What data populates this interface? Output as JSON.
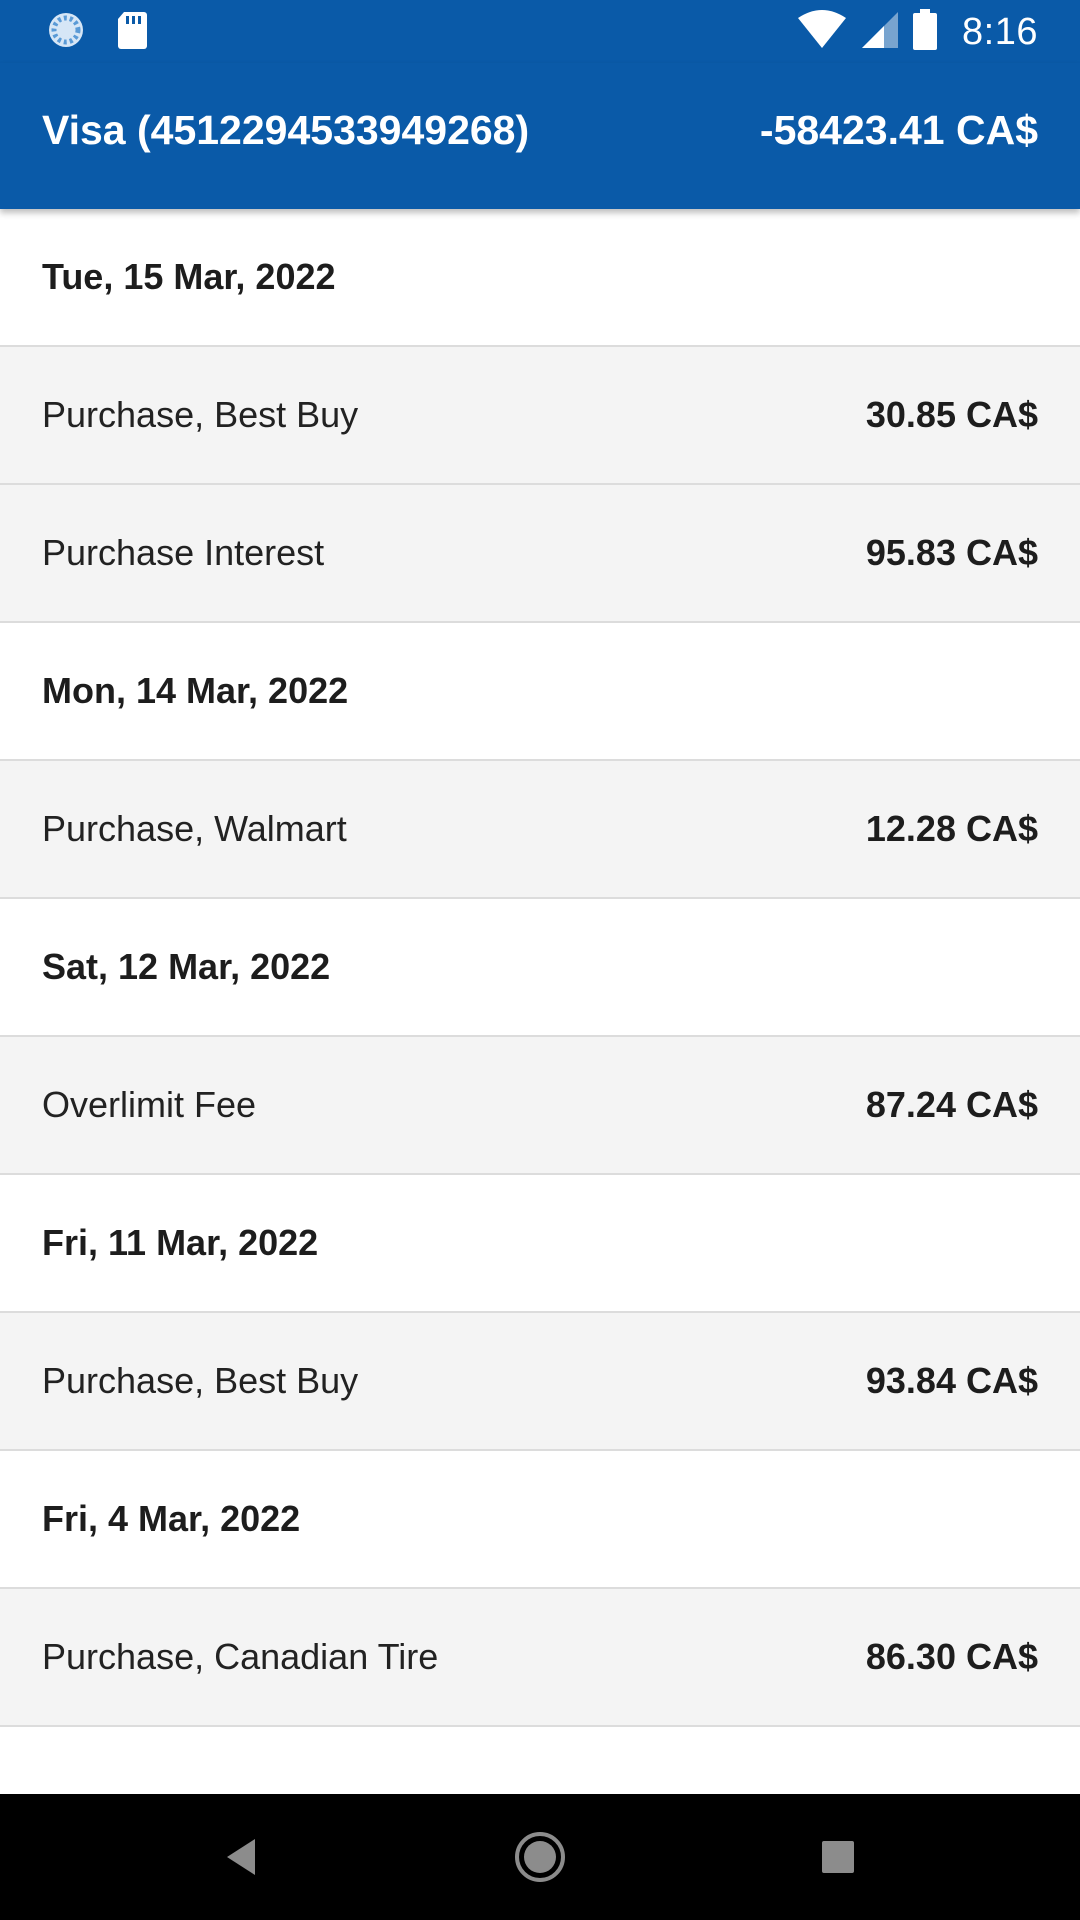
{
  "status_bar": {
    "time": "8:16",
    "icons": [
      "loading-icon",
      "sd-card-icon",
      "wifi-icon",
      "cell-signal-icon",
      "battery-icon"
    ],
    "color": "#0a5aa8"
  },
  "app_bar": {
    "title": "Visa (4512294533949268)",
    "balance": "-58423.41 CA$",
    "color": "#0a5aa8"
  },
  "groups": [
    {
      "date": "Tue, 15 Mar, 2022",
      "transactions": [
        {
          "description": "Purchase, Best Buy",
          "amount": "30.85 CA$"
        },
        {
          "description": "Purchase Interest",
          "amount": "95.83 CA$"
        }
      ]
    },
    {
      "date": "Mon, 14 Mar, 2022",
      "transactions": [
        {
          "description": "Purchase, Walmart",
          "amount": "12.28 CA$"
        }
      ]
    },
    {
      "date": "Sat, 12 Mar, 2022",
      "transactions": [
        {
          "description": "Overlimit Fee",
          "amount": "87.24 CA$"
        }
      ]
    },
    {
      "date": "Fri, 11 Mar, 2022",
      "transactions": [
        {
          "description": "Purchase, Best Buy",
          "amount": "93.84 CA$"
        }
      ]
    },
    {
      "date": "Fri, 4 Mar, 2022",
      "transactions": [
        {
          "description": "Purchase, Canadian Tire",
          "amount": "86.30 CA$"
        }
      ]
    }
  ],
  "nav_bar": {
    "buttons": [
      "back-icon",
      "home-icon",
      "recents-icon"
    ]
  }
}
